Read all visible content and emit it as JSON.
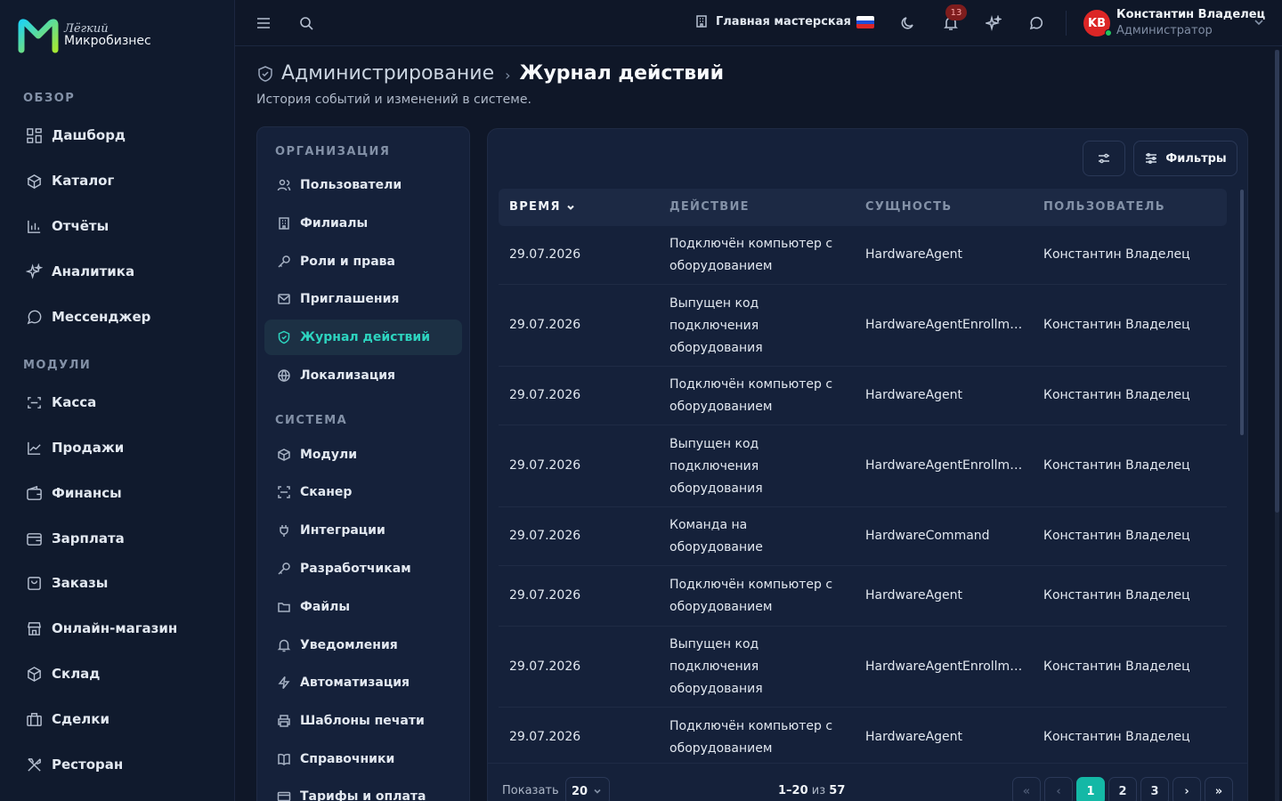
{
  "brand": {
    "top": "Лёгкий",
    "bottom": "Микробизнес"
  },
  "sidebar": {
    "section_overview": "ОБЗОР",
    "section_modules": "МОДУЛИ",
    "items": [
      {
        "label": "Дашборд",
        "icon": "dashboard-icon"
      },
      {
        "label": "Каталог",
        "icon": "catalog-icon"
      },
      {
        "label": "Отчёты",
        "icon": "reports-icon"
      },
      {
        "label": "Аналитика",
        "icon": "sparkles-icon"
      },
      {
        "label": "Мессенджер",
        "icon": "chat-icon"
      },
      {
        "label": "Касса",
        "icon": "scan-icon"
      },
      {
        "label": "Продажи",
        "icon": "chart-line-icon"
      },
      {
        "label": "Финансы",
        "icon": "wallet-icon"
      },
      {
        "label": "Зарплата",
        "icon": "payroll-icon"
      },
      {
        "label": "Заказы",
        "icon": "orders-icon"
      },
      {
        "label": "Онлайн-магазин",
        "icon": "store-icon"
      },
      {
        "label": "Склад",
        "icon": "box-icon"
      },
      {
        "label": "Сделки",
        "icon": "briefcase-icon"
      },
      {
        "label": "Ресторан",
        "icon": "cutlery-icon"
      }
    ]
  },
  "topbar": {
    "workshop": "Главная мастерская",
    "notifications_count": "13",
    "user_initials": "KB",
    "user_name": "Константин Владелец",
    "user_role": "Администратор"
  },
  "header": {
    "crumb_parent": "Администрирование",
    "crumb_sep": "›",
    "crumb_current": "Журнал действий",
    "subtitle": "История событий и изменений в системе."
  },
  "settings_nav": {
    "section_org": "ОРГАНИЗАЦИЯ",
    "section_system": "СИСТЕМА",
    "org_items": [
      {
        "label": "Пользователи",
        "icon": "users-icon"
      },
      {
        "label": "Филиалы",
        "icon": "building-icon"
      },
      {
        "label": "Роли и права",
        "icon": "key-icon"
      },
      {
        "label": "Приглашения",
        "icon": "mail-icon"
      },
      {
        "label": "Журнал действий",
        "icon": "shield-icon",
        "active": true
      },
      {
        "label": "Локализация",
        "icon": "globe-icon"
      }
    ],
    "system_items": [
      {
        "label": "Модули",
        "icon": "cube-icon"
      },
      {
        "label": "Сканер",
        "icon": "scan-icon"
      },
      {
        "label": "Интеграции",
        "icon": "plug-icon"
      },
      {
        "label": "Разработчикам",
        "icon": "key-icon"
      },
      {
        "label": "Файлы",
        "icon": "folder-icon"
      },
      {
        "label": "Уведомления",
        "icon": "bell-icon"
      },
      {
        "label": "Автоматизация",
        "icon": "bolt-icon"
      },
      {
        "label": "Шаблоны печати",
        "icon": "printer-icon"
      },
      {
        "label": "Справочники",
        "icon": "book-icon"
      },
      {
        "label": "Тарифы и оплата",
        "icon": "card-icon"
      }
    ]
  },
  "table": {
    "filters_label": "Фильтры",
    "columns": [
      "ВРЕМЯ",
      "ДЕЙСТВИЕ",
      "СУЩНОСТЬ",
      "ПОЛЬЗОВАТЕЛЬ"
    ],
    "rows": [
      {
        "time": "29.07.2026",
        "action": "Подключён компьютер с оборудованием",
        "entity": "HardwareAgent",
        "user": "Константин Владелец"
      },
      {
        "time": "29.07.2026",
        "action": "Выпущен код подключения оборудования",
        "entity": "HardwareAgentEnrollment",
        "user": "Константин Владелец"
      },
      {
        "time": "29.07.2026",
        "action": "Подключён компьютер с оборудованием",
        "entity": "HardwareAgent",
        "user": "Константин Владелец"
      },
      {
        "time": "29.07.2026",
        "action": "Выпущен код подключения оборудования",
        "entity": "HardwareAgentEnrollment",
        "user": "Константин Владелец"
      },
      {
        "time": "29.07.2026",
        "action": "Команда на оборудование",
        "entity": "HardwareCommand",
        "user": "Константин Владелец"
      },
      {
        "time": "29.07.2026",
        "action": "Подключён компьютер с оборудованием",
        "entity": "HardwareAgent",
        "user": "Константин Владелец"
      },
      {
        "time": "29.07.2026",
        "action": "Выпущен код подключения оборудования",
        "entity": "HardwareAgentEnrollment",
        "user": "Константин Владелец"
      },
      {
        "time": "29.07.2026",
        "action": "Подключён компьютер с оборудованием",
        "entity": "HardwareAgent",
        "user": "Константин Владелец"
      }
    ]
  },
  "pagination": {
    "show_label": "Показать",
    "page_size": "20",
    "range": "1–20",
    "of": "из",
    "total": "57",
    "first": "«",
    "prev": "‹",
    "pages": [
      "1",
      "2",
      "3"
    ],
    "current_page": "1",
    "next": "›",
    "last": "»"
  },
  "colors": {
    "accent": "#14b8a6",
    "accent_text": "#2dd4bf",
    "danger": "#dc2626",
    "bg": "#0f1728",
    "panel": "#15213a"
  }
}
